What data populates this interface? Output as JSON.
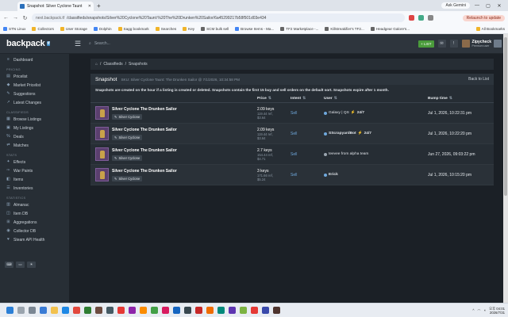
{
  "browser": {
    "tab_title": "Snapshot: Silver Cyclone Taunt",
    "url_prefix": "next.backpack.tf",
    "url_path": "/classifieds/snapshots/Silver%20Cyclone%20Taunt:%20The%20Drunken%20Sailor/6a45299217b58f501d03e434",
    "gemini": "Ask Gemini",
    "relaunch": "Relaunch to update",
    "all_bookmarks": "All Bookmarks",
    "bookmarks": [
      "STN Linux",
      "Collectors",
      "User Storage",
      "Dolphin",
      "Sagg bookmark",
      "Searches",
      "Key",
      "SCM bulk sell",
      "Browse Items - Ma...",
      "TF2 Marketplace -...",
      "Killstreakifier's TF2...",
      "Headgear Galore's..."
    ]
  },
  "site": {
    "logo": "backpack",
    "logo_badge": "tf",
    "search_placeholder": "Search...",
    "add_label": "+ LIST",
    "user_name": "Zipycheck",
    "user_sub": "Premium user"
  },
  "sidebar": {
    "top": [
      {
        "label": "Dashboard",
        "icon": "≡"
      }
    ],
    "sections": [
      {
        "title": "PRICING",
        "items": [
          {
            "label": "Pricelist",
            "icon": "▤"
          },
          {
            "label": "Market Pricelist",
            "icon": "◆"
          },
          {
            "label": "Suggestions",
            "icon": "✎"
          },
          {
            "label": "Latest Changes",
            "icon": "↗"
          }
        ]
      },
      {
        "title": "CLASSIFIEDS",
        "items": [
          {
            "label": "Browse Listings",
            "icon": "▦"
          },
          {
            "label": "My Listings",
            "icon": "▣"
          },
          {
            "label": "Deals",
            "icon": "%"
          },
          {
            "label": "Matches",
            "icon": "⇄"
          }
        ]
      },
      {
        "title": "STATS",
        "items": [
          {
            "label": "Effects",
            "icon": "✦"
          },
          {
            "label": "War Paints",
            "icon": "✑"
          },
          {
            "label": "Items",
            "icon": "◧"
          },
          {
            "label": "Inventories",
            "icon": "☰"
          }
        ]
      },
      {
        "title": "STATISTICS",
        "items": [
          {
            "label": "Almanac",
            "icon": "▥"
          },
          {
            "label": "Item DB",
            "icon": "◫"
          },
          {
            "label": "Aggregations",
            "icon": "⊞"
          },
          {
            "label": "Collector DB",
            "icon": "◉"
          },
          {
            "label": "Steam API Health",
            "icon": "♥"
          }
        ]
      }
    ],
    "footer_icons": [
      "⌨",
      "▭",
      "☀"
    ]
  },
  "breadcrumb": {
    "home": "⌂",
    "parts": [
      "Classifieds",
      "Snapshots"
    ]
  },
  "panel": {
    "title": "Snapshot",
    "sku": "SKU: Silver Cyclone Taunt: The Drunken Sailor @ 7/1/2026, 10:34:58 PM",
    "back": "Back to List",
    "note": "Snapshots are created on the hour if a listing is created or deleted. Snapshots contain the first 15 buy and sell orders on the default sort. Snapshots expire after 1 month.",
    "columns": {
      "price": "Price",
      "intent": "Intent",
      "user": "User",
      "bump": "Bump time"
    },
    "rows": [
      {
        "name": "Silver Cyclone The Drunken Sailor",
        "tag": "Silver Cyclone",
        "keys": "2.09 keys",
        "ref": "119.44 ref,",
        "usd": "$3.64",
        "intent": "Sell",
        "user": "Galaxy | QS",
        "bolt": true,
        "badge": "24/7",
        "user_bold": false,
        "dot": "blue",
        "bump": "Jul 1, 2026, 10:22:31 pm"
      },
      {
        "name": "Silver Cyclone The Drunken Sailor",
        "tag": "Silver Cyclone",
        "keys": "2.09 keys",
        "ref": "119.44 ref,",
        "usd": "$3.64",
        "intent": "Sell",
        "user": "SScrapyardBot",
        "bolt": true,
        "badge": "24/7",
        "user_bold": true,
        "dot": "blue",
        "bump": "Jul 1, 2026, 10:22:20 pm"
      },
      {
        "name": "Silver Cyclone The Drunken Sailor",
        "tag": "Silver Cyclone",
        "keys": "2.7 keys",
        "ref": "154.44 ref,",
        "usd": "$4.71",
        "intent": "Sell",
        "user": "teevee from alpha team",
        "bolt": false,
        "badge": "",
        "user_bold": false,
        "dot": "grey",
        "bump": "Jun 27, 2026, 09:03:22 pm"
      },
      {
        "name": "Silver Cyclone The Drunken Sailor",
        "tag": "Silver Cyclone",
        "keys": "3 keys",
        "ref": "171.66 ref,",
        "usd": "$5.24",
        "intent": "Sell",
        "user": "Erick",
        "bolt": false,
        "badge": "",
        "user_bold": true,
        "dot": "blue",
        "bump": "Jul 1, 2026, 10:15:20 pm"
      }
    ]
  },
  "taskbar": {
    "time": "오후 04:01",
    "date": "2026/7/31"
  }
}
